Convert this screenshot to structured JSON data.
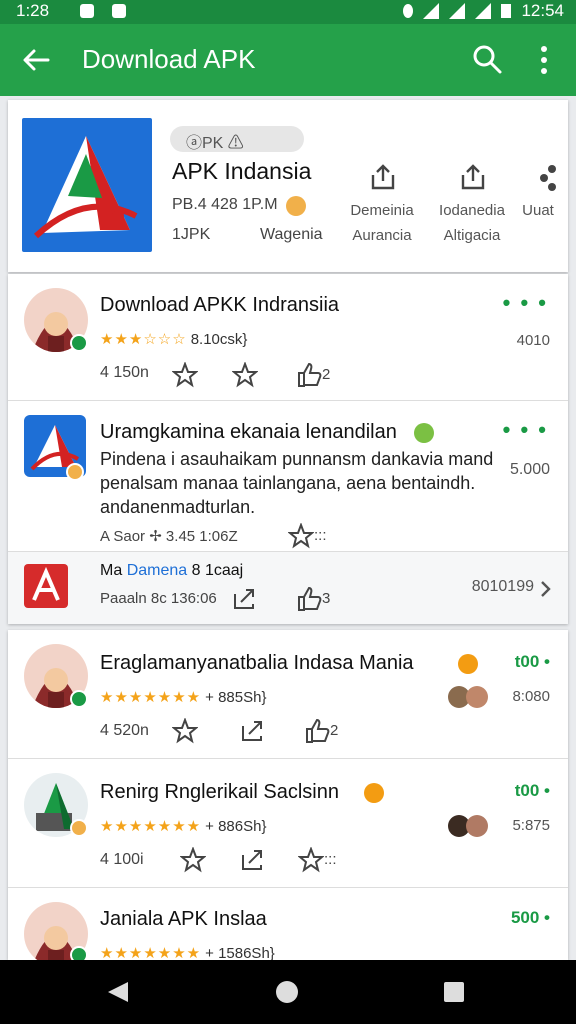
{
  "status": {
    "time": "1:28",
    "clock": "12:54"
  },
  "appbar": {
    "title": "Download APK"
  },
  "header": {
    "logo_icon": "apk-indonesia-logo",
    "chip": "ⓐPK ⚠",
    "title": "APK Indansia",
    "meta1": "PB.4 428 1P.M",
    "meta2": "1JPK",
    "meta3": "Wagenia",
    "actions": [
      {
        "icon": "share-icon",
        "line1": "Demeinia",
        "line2": "Aurancia"
      },
      {
        "icon": "share-icon",
        "line1": "Iodanedia",
        "line2": "Altigacia"
      },
      {
        "icon": "share-icon",
        "line1": "Uuat",
        "line2": ""
      }
    ]
  },
  "items": [
    {
      "title": "Download APKK Indransiia",
      "stars": "★★★☆☆☆",
      "rating": "8.10csk}",
      "count": "4 150n",
      "right_top": "• • •",
      "right_val": "4010",
      "act3_n": "2"
    },
    {
      "title": "Uramgkamina ekanaia lenandilan",
      "desc": "Pindena i asauhaikam punnansm dankavia mand penalsam manaa tainlangana, aena bentaindh. andanenmadturlan.",
      "rating_row": "A Saor   ✢ 3.45 1:06Z",
      "act_n": ":::",
      "right_top": "• • •",
      "right_val": "5.000"
    },
    {
      "title": "Eraglamanyanatbalia Indasa Mania",
      "stars": "★★★★★★★",
      "rating": "+ 885Sh}",
      "count": "4 520n",
      "right_top": "t00 •",
      "right_val": "8:080",
      "act3_n": "2"
    },
    {
      "title": "Renirg Rnglerikail Saclsinn",
      "stars": "★★★★★★★",
      "rating": "+ 886Sh}",
      "count": "4 100i",
      "right_top": "t00 •",
      "right_val": "5:875",
      "act3_n": ":::"
    },
    {
      "title": "Janiala APK Inslaa",
      "stars": "★★★★★★★",
      "rating": "+ 1586Sh}",
      "right_top": "500 •"
    }
  ],
  "sub_item": {
    "title_a": "Ma",
    "title_b": "Damena",
    "title_c": "8 1caaj",
    "line2": "Paaaln  8c 136:06",
    "act_n": "3",
    "right": "8010199"
  },
  "colors": {
    "green": "#25a14a",
    "dark_green": "#1b8a3f",
    "star": "#f4a31a"
  }
}
